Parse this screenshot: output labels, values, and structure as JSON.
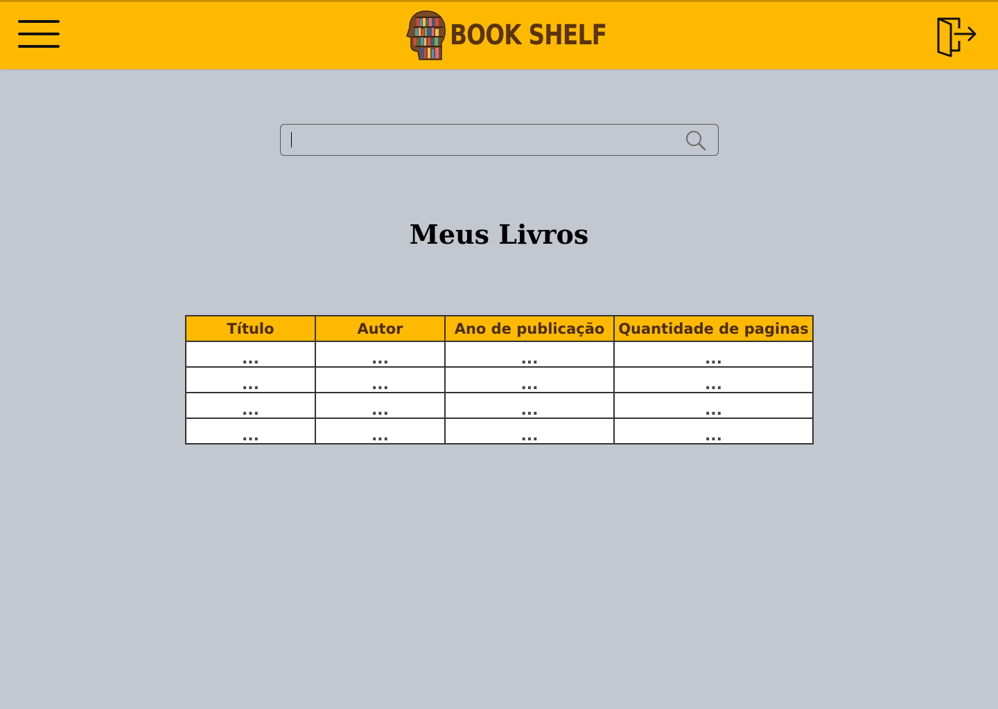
{
  "header": {
    "brand_name": "BOOK SHELF",
    "accent_color": "#ffba00",
    "icons": {
      "menu": "hamburger-menu-icon",
      "logo": "bookshelf-head-logo-icon",
      "logout": "logout-door-icon"
    }
  },
  "search": {
    "value": "",
    "placeholder": "",
    "icon": "search-icon"
  },
  "main": {
    "title": "Meus Livros"
  },
  "table": {
    "headers": [
      "Título",
      "Autor",
      "Ano de publicação",
      "Quantidade de paginas"
    ],
    "rows": [
      [
        "...",
        "...",
        "...",
        "..."
      ],
      [
        "...",
        "...",
        "...",
        "..."
      ],
      [
        "...",
        "...",
        "...",
        "..."
      ],
      [
        "...",
        "...",
        "...",
        "..."
      ]
    ]
  }
}
